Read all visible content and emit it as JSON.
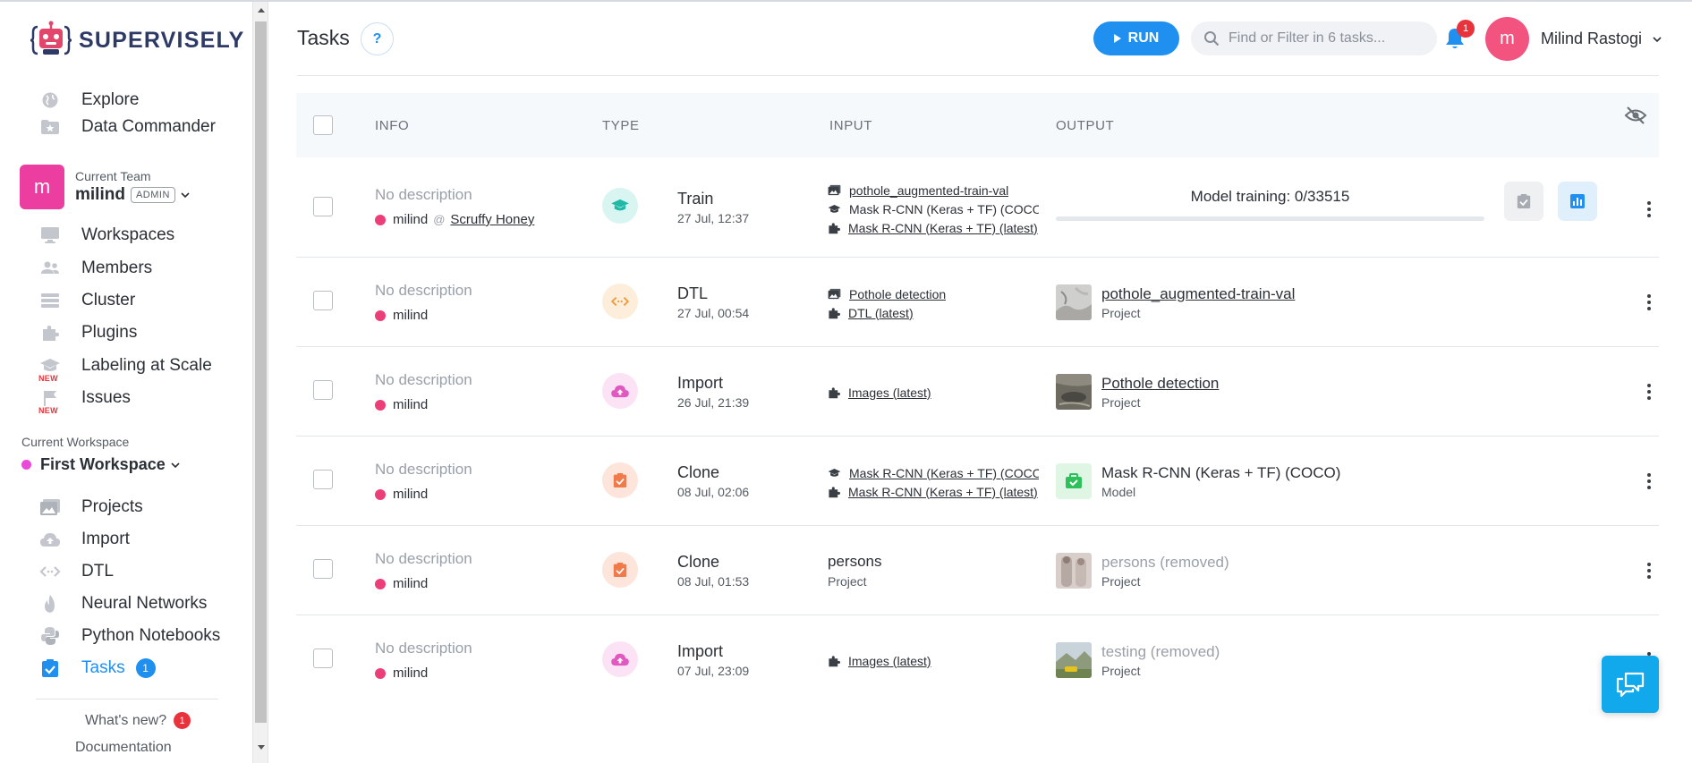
{
  "brand": {
    "name": "SUPERVISELY"
  },
  "sidebar": {
    "top_items": [
      {
        "label": "Explore",
        "icon": "globe-icon"
      },
      {
        "label": "Data Commander",
        "icon": "folder-star-icon"
      }
    ],
    "team": {
      "caption": "Current Team",
      "avatar_letter": "m",
      "name": "milind",
      "role": "ADMIN"
    },
    "team_items": [
      {
        "label": "Workspaces",
        "icon": "monitor-icon"
      },
      {
        "label": "Members",
        "icon": "people-icon"
      },
      {
        "label": "Cluster",
        "icon": "server-icon"
      },
      {
        "label": "Plugins",
        "icon": "puzzle-icon"
      },
      {
        "label": "Labeling at Scale",
        "icon": "graduation-cap-icon",
        "badge": "NEW"
      },
      {
        "label": "Issues",
        "icon": "flag-icon",
        "badge": "NEW"
      }
    ],
    "workspace": {
      "caption": "Current Workspace",
      "name": "First Workspace"
    },
    "workspace_items": [
      {
        "label": "Projects",
        "icon": "images-icon"
      },
      {
        "label": "Import",
        "icon": "cloud-upload-icon"
      },
      {
        "label": "DTL",
        "icon": "code-icon"
      },
      {
        "label": "Neural Networks",
        "icon": "flame-icon"
      },
      {
        "label": "Python Notebooks",
        "icon": "python-icon"
      },
      {
        "label": "Tasks",
        "icon": "clipboard-check-icon",
        "count": "1",
        "active": true
      }
    ],
    "whats_new": {
      "label": "What's new?",
      "count": "1"
    },
    "documentation": "Documentation"
  },
  "header": {
    "title": "Tasks",
    "help_label": "?",
    "run_label": "RUN",
    "search_placeholder": "Find or Filter in 6 tasks...",
    "notifications_count": "1",
    "user": {
      "avatar_letter": "m",
      "name": "Milind Rastogi"
    }
  },
  "table": {
    "columns": {
      "info": "INFO",
      "type": "TYPE",
      "input": "INPUT",
      "output": "OUTPUT"
    },
    "rows": [
      {
        "description": "No description",
        "owner": "milind",
        "owner_at": "@",
        "session": "Scruffy Honey",
        "type": "Train",
        "type_icon": "graduation-cap-icon",
        "date": "27 Jul, 12:37",
        "inputs": [
          {
            "icon": "images-icon",
            "text": "pothole_augmented-train-val",
            "link": true
          },
          {
            "icon": "graduation-cap-icon",
            "text": "Mask R-CNN (Keras + TF) (COCO)",
            "link": false
          },
          {
            "icon": "puzzle-icon",
            "text": "Mask R-CNN (Keras + TF) (latest)",
            "link": true
          }
        ],
        "progress": {
          "label": "Model training: 0/33515",
          "percent": 0
        }
      },
      {
        "description": "No description",
        "owner": "milind",
        "type": "DTL",
        "type_icon": "code-icon",
        "date": "27 Jul, 00:54",
        "inputs": [
          {
            "icon": "images-icon",
            "text": "Pothole detection",
            "link": true
          },
          {
            "icon": "puzzle-icon",
            "text": "DTL (latest)",
            "link": true
          }
        ],
        "output": {
          "name": "pothole_augmented-train-val",
          "kind": "Project",
          "link": true,
          "thumb": "project-thumb-icon"
        }
      },
      {
        "description": "No description",
        "owner": "milind",
        "type": "Import",
        "type_icon": "cloud-upload-icon",
        "date": "26 Jul, 21:39",
        "inputs": [
          {
            "icon": "puzzle-icon",
            "text": "Images (latest)",
            "link": true
          }
        ],
        "output": {
          "name": "Pothole detection",
          "kind": "Project",
          "link": true,
          "thumb": "project-thumb-icon"
        }
      },
      {
        "description": "No description",
        "owner": "milind",
        "type": "Clone",
        "type_icon": "clipboard-check-icon",
        "date": "08 Jul, 02:06",
        "inputs": [
          {
            "icon": "graduation-cap-icon",
            "text": "Mask R-CNN (Keras + TF) (COCO)",
            "link": true
          },
          {
            "icon": "puzzle-icon",
            "text": "Mask R-CNN (Keras + TF) (latest)",
            "link": true
          }
        ],
        "output": {
          "name": "Mask R-CNN (Keras + TF) (COCO)",
          "kind": "Model",
          "link": false,
          "thumb": "model-bag-icon"
        }
      },
      {
        "description": "No description",
        "owner": "milind",
        "type": "Clone",
        "type_icon": "clipboard-check-icon",
        "date": "08 Jul, 01:53",
        "input_plain": {
          "name": "persons",
          "kind": "Project"
        },
        "output": {
          "name": "persons (removed)",
          "kind": "Project",
          "removed": true,
          "thumb": "project-thumb-icon"
        }
      },
      {
        "description": "No description",
        "owner": "milind",
        "type": "Import",
        "type_icon": "cloud-upload-icon",
        "date": "07 Jul, 23:09",
        "inputs": [
          {
            "icon": "puzzle-icon",
            "text": "Images (latest)",
            "link": true
          }
        ],
        "output": {
          "name": "testing (removed)",
          "kind": "Project",
          "removed": true,
          "thumb": "project-thumb-icon"
        }
      }
    ]
  },
  "colors": {
    "accent": "#1f8ff0",
    "team_avatar": "#ec3ea0",
    "user_avatar": "#f2537f",
    "badge_red": "#e8323c",
    "chat": "#11a9ec"
  }
}
